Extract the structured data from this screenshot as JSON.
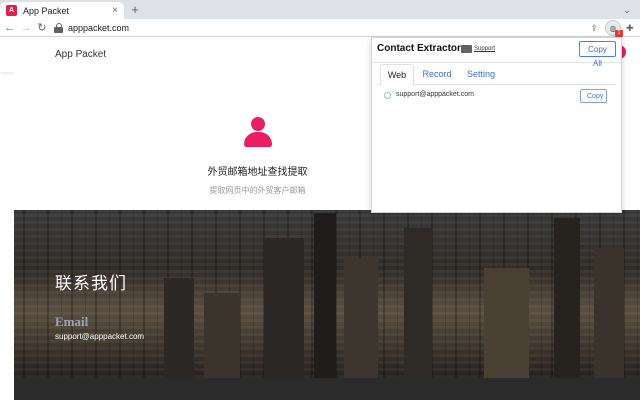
{
  "browser": {
    "tab_title": "App Packet",
    "tab_close": "×",
    "new_tab": "+",
    "url": "apppacket.com",
    "back": "←",
    "forward": "→",
    "reload": "C",
    "share_icon": "share-icon",
    "bookmark_icon": "star-icon",
    "extension_badge": "1",
    "favicon_text": "A"
  },
  "site": {
    "logo_text": "App Packet",
    "hero_title": "外贸邮箱地址查找提取",
    "hero_subtitle": "提取网页中的外贸客户邮箱",
    "contact_title": "联系我们",
    "email_label": "Email",
    "email_value": "support@apppacket.com"
  },
  "popup": {
    "title": "Contact Extractor",
    "support_link": "Support",
    "copy_all_label": "Copy All",
    "tabs": [
      {
        "label": "Web",
        "active": true
      },
      {
        "label": "Record",
        "active": false
      },
      {
        "label": "Setting",
        "active": false
      }
    ],
    "results": [
      {
        "email": "support@apppacket.com",
        "copy_label": "Copy"
      }
    ]
  },
  "colors": {
    "accent_pink": "#e91e63",
    "link_blue": "#3b6fcf"
  }
}
